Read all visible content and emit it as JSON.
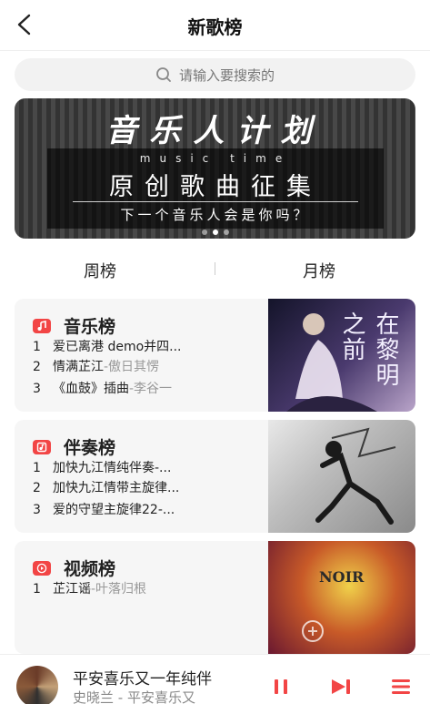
{
  "header": {
    "title": "新歌榜"
  },
  "search": {
    "placeholder": "请输入要搜索的"
  },
  "banner": {
    "headline": "音乐人计划",
    "subtitle": "music time",
    "main": "原创歌曲征集",
    "tagline": "下一个音乐人会是你吗？"
  },
  "tabs": [
    {
      "label": "周榜"
    },
    {
      "label": "月榜"
    }
  ],
  "charts": [
    {
      "title": "音乐榜",
      "icon": "music-note-icon",
      "tracks": [
        {
          "num": "1",
          "name": "爱已离港 demo并四...",
          "artist": ""
        },
        {
          "num": "2",
          "name": "情满芷江",
          "artist": "-傲日其愣"
        },
        {
          "num": "3",
          "name": "《血鼓》插曲",
          "artist": "-李谷一"
        }
      ],
      "cover_text": "在黎明之前"
    },
    {
      "title": "伴奏榜",
      "icon": "accompaniment-icon",
      "tracks": [
        {
          "num": "1",
          "name": "加快九江情纯伴奏-...",
          "artist": ""
        },
        {
          "num": "2",
          "name": "加快九江情带主旋律...",
          "artist": ""
        },
        {
          "num": "3",
          "name": "爱的守望主旋律22-...",
          "artist": ""
        }
      ],
      "cover_text": ""
    },
    {
      "title": "视频榜",
      "icon": "video-play-icon",
      "tracks": [
        {
          "num": "1",
          "name": "芷江谣",
          "artist": "-叶落归根"
        }
      ],
      "cover_text": "NOIR"
    }
  ],
  "player": {
    "title": "平安喜乐又一年纯伴",
    "subtitle": "史晓兰 - 平安喜乐又"
  },
  "colors": {
    "accent": "#f24545"
  }
}
